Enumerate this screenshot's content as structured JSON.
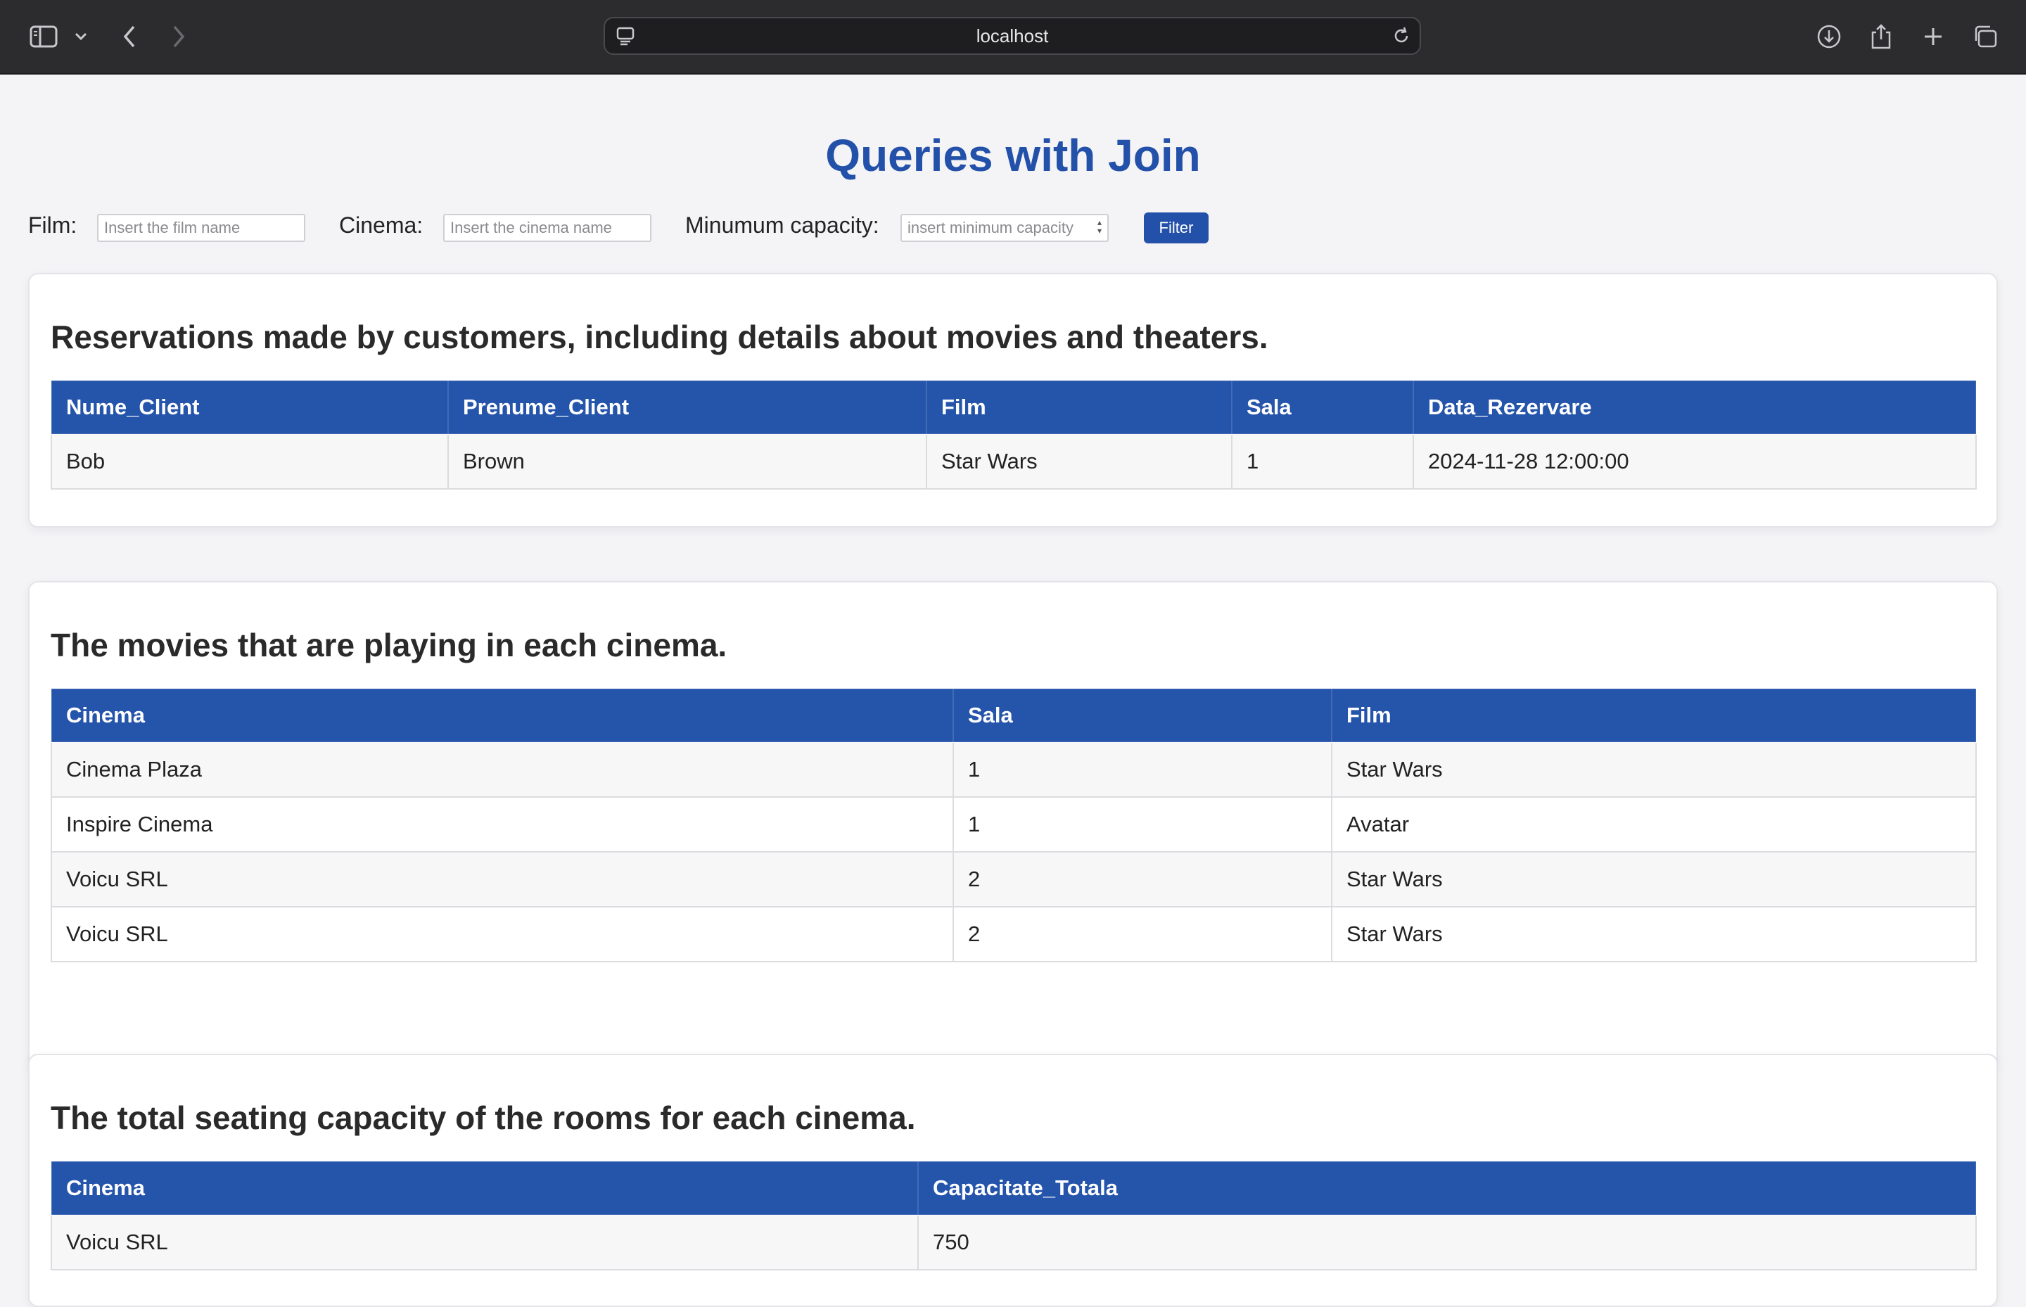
{
  "browser": {
    "url": "localhost",
    "icons": [
      "sidebar-icon",
      "chevron-down-icon",
      "back-icon",
      "forward-icon",
      "site-settings-icon",
      "reload-icon",
      "download-icon",
      "share-icon",
      "new-tab-icon",
      "tab-overview-icon"
    ]
  },
  "page": {
    "title": "Queries with Join"
  },
  "filters": {
    "film_label": "Film:",
    "film_placeholder": "Insert the film name",
    "cinema_label": "Cinema:",
    "cinema_placeholder": "Insert the cinema name",
    "capacity_label": "Minumum capacity:",
    "capacity_placeholder": "insert minimum capacity",
    "filter_button": "Filter"
  },
  "sections": [
    {
      "heading": "Reservations made by customers, including details about movies and theaters.",
      "columns": [
        "Nume_Client",
        "Prenume_Client",
        "Film",
        "Sala",
        "Data_Rezervare"
      ],
      "rows": [
        [
          "Bob",
          "Brown",
          "Star Wars",
          "1",
          "2024-11-28 12:00:00"
        ]
      ]
    },
    {
      "heading": "The movies that are playing in each cinema.",
      "columns": [
        "Cinema",
        "Sala",
        "Film"
      ],
      "rows": [
        [
          "Cinema Plaza",
          "1",
          "Star Wars"
        ],
        [
          "Inspire Cinema",
          "1",
          "Avatar"
        ],
        [
          "Voicu SRL",
          "2",
          "Star Wars"
        ],
        [
          "Voicu SRL",
          "2",
          "Star Wars"
        ]
      ]
    },
    {
      "heading": "The total seating capacity of the rooms for each cinema.",
      "columns": [
        "Cinema",
        "Capacitate_Totala"
      ],
      "rows": [
        [
          "Voicu SRL",
          "750"
        ]
      ]
    }
  ],
  "colors": {
    "accent": "#2350a8",
    "header_bg": "#2554ab",
    "chrome_bg": "#2c2c2e"
  }
}
